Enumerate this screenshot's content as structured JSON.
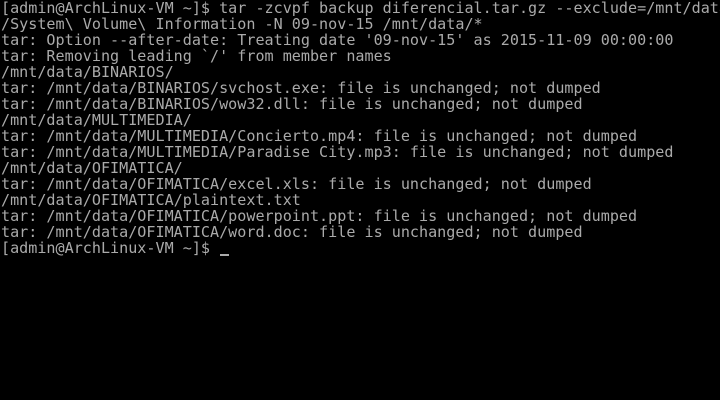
{
  "terminal": {
    "lines": [
      "[admin@ArchLinux-VM ~]$ tar -zcvpf backup_diferencial.tar.gz --exclude=/mnt/data",
      "/System\\ Volume\\ Information -N 09-nov-15 /mnt/data/*",
      "tar: Option --after-date: Treating date '09-nov-15' as 2015-11-09 00:00:00",
      "tar: Removing leading `/' from member names",
      "/mnt/data/BINARIOS/",
      "tar: /mnt/data/BINARIOS/svchost.exe: file is unchanged; not dumped",
      "tar: /mnt/data/BINARIOS/wow32.dll: file is unchanged; not dumped",
      "/mnt/data/MULTIMEDIA/",
      "tar: /mnt/data/MULTIMEDIA/Concierto.mp4: file is unchanged; not dumped",
      "tar: /mnt/data/MULTIMEDIA/Paradise City.mp3: file is unchanged; not dumped",
      "/mnt/data/OFIMATICA/",
      "tar: /mnt/data/OFIMATICA/excel.xls: file is unchanged; not dumped",
      "/mnt/data/OFIMATICA/plaintext.txt",
      "tar: /mnt/data/OFIMATICA/powerpoint.ppt: file is unchanged; not dumped",
      "tar: /mnt/data/OFIMATICA/word.doc: file is unchanged; not dumped"
    ],
    "prompt": "[admin@ArchLinux-VM ~]$ ",
    "colors": {
      "background": "#000000",
      "foreground": "#aaaaaa"
    }
  }
}
